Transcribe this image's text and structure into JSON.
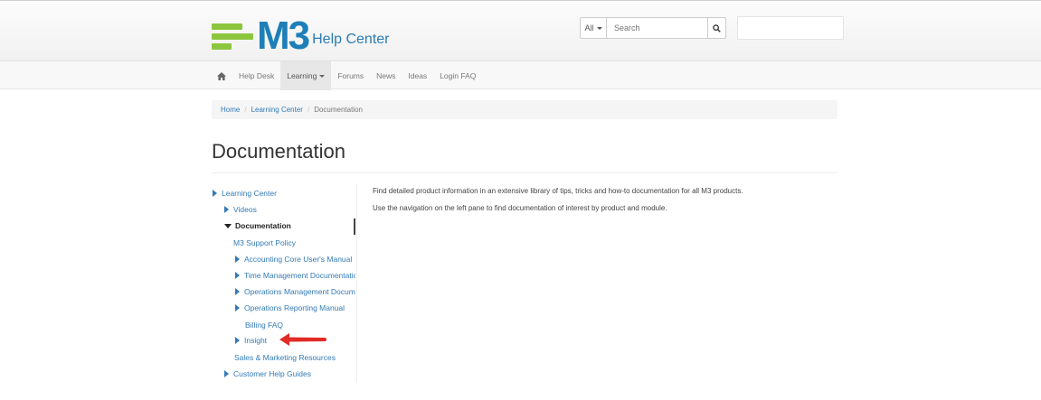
{
  "header": {
    "logo_text": "M3",
    "logo_subtitle": "Help Center",
    "search_scope": "All",
    "search_placeholder": "Search",
    "search_icon": "magnifier-icon"
  },
  "nav": {
    "home_icon": "home-icon",
    "items": [
      {
        "label": "Help Desk"
      },
      {
        "label": "Learning",
        "active": true,
        "dropdown": true
      },
      {
        "label": "Forums"
      },
      {
        "label": "News"
      },
      {
        "label": "Ideas"
      },
      {
        "label": "Login FAQ"
      }
    ]
  },
  "breadcrumb": {
    "items": [
      "Home",
      "Learning Center"
    ],
    "current": "Documentation",
    "separator": "/"
  },
  "page": {
    "title": "Documentation"
  },
  "tree": {
    "items": [
      {
        "label": "Learning Center",
        "level": 0,
        "state": "collapsed"
      },
      {
        "label": "Videos",
        "level": 1,
        "state": "collapsed"
      },
      {
        "label": "Documentation",
        "level": 1,
        "state": "expanded",
        "active": true
      },
      {
        "label": "M3 Support Policy",
        "level": 2,
        "state": "leaf"
      },
      {
        "label": "Accounting Core User's Manual",
        "level": 2,
        "state": "collapsed"
      },
      {
        "label": "Time Management Documentation",
        "level": 2,
        "state": "collapsed"
      },
      {
        "label": "Operations Management Documentation",
        "level": 2,
        "state": "collapsed"
      },
      {
        "label": "Operations Reporting Manual",
        "level": 2,
        "state": "collapsed"
      },
      {
        "label": "Billing FAQ",
        "level": 2,
        "state": "leaf"
      },
      {
        "label": "Insight",
        "level": 2,
        "state": "collapsed"
      },
      {
        "label": "Sales & Marketing Resources",
        "level": 1,
        "state": "leaf"
      },
      {
        "label": "Customer Help Guides",
        "level": 1,
        "state": "collapsed"
      }
    ]
  },
  "content": {
    "paragraphs": [
      "Find detailed product information in an extensive library of tips, tricks and how-to documentation for all M3 products.",
      "Use the navigation on the left pane to find documentation of interest by product and module."
    ]
  },
  "colors": {
    "link": "#337ab7",
    "logo_green": "#8cc63f",
    "logo_blue": "#1e7fb8",
    "annotation_arrow": "#e02b27"
  }
}
